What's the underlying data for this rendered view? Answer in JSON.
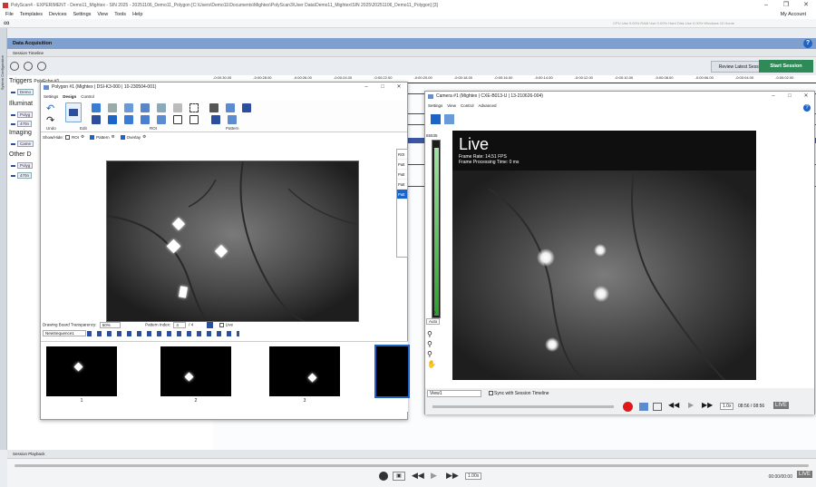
{
  "app": {
    "title": "PolyScan4 - EXPERIMENT - Demo11_Mightex - SIN 2025 - 20251106_Demo11_Polygon [C:\\Users\\Demo11\\Documents\\Mightex\\PolyScan3\\User Data\\Demo11_Mightex\\SIN 2025\\20251106_Demo11_Polygon] [3]",
    "account": "My Account",
    "status": "CPU Use 0.00%  RAM Use 0.00%  Hard Disk Use 0.00%  Windows 10 Home",
    "menu": [
      "File",
      "Templates",
      "Devices",
      "Settings",
      "View",
      "Tools",
      "Help"
    ]
  },
  "side_label": "System Configuration",
  "data_acq": {
    "header": "Data Acquisition",
    "session_timeline": "Session Timeline",
    "review_btn": "Review Latest Session",
    "start_btn": "Start Session"
  },
  "ruler_ticks": [
    "-0:00:30.00",
    "-0:00:28.00",
    "-0:00:26.00",
    "-0:00:24.00",
    "-0:00:22.00",
    "-0:00:20.00",
    "-0:00:18.00",
    "-0:00:16.00",
    "-0:00:14.00",
    "-0:00:12.00",
    "-0:00:10.00",
    "-0:00:08.00",
    "-0:00:06.00",
    "-0:00:04.00",
    "-0:00:02.00"
  ],
  "timeline": {
    "sections": [
      "Triggers",
      "Illuminat",
      "Imaging",
      "Other D"
    ],
    "triggers_sub": "PolyEcho #1",
    "items": [
      "Demo",
      "Polyg",
      "470n",
      "Came",
      "Polyg",
      "470n"
    ]
  },
  "polygon": {
    "title": "Polygon #1 (Mightex | DSI-K3-000 | 10-230504-001)",
    "tabs": [
      "Settings",
      "Design",
      "Control"
    ],
    "calibrated": "Calibrated",
    "groups": [
      "Undo",
      "Edit",
      "ROI",
      "Pattern"
    ],
    "showhide": "Show/Hide:",
    "roi_label": "ROI",
    "pattern_label": "Pattern",
    "overlay_label": "Overlay",
    "roi_list_head": "ROI",
    "roi_list": [
      "Patt",
      "Patt",
      "Patt",
      "Patt"
    ],
    "transparency_label": "Drawing Board Transparency:",
    "transparency_value": "50%",
    "pattern_index_label": "Pattern Index:",
    "pattern_index": "4",
    "pattern_total": "/ 4",
    "live_label": "Live",
    "sequence": "NewSequence1",
    "thumb_labels": [
      "1",
      "2",
      "3"
    ]
  },
  "camera": {
    "title": "Camera #1 (Mightex | CXE-B013-U | 13-210626-004)",
    "tabs": [
      "Settings",
      "View",
      "Control",
      "Advanced"
    ],
    "hist_max": "65535",
    "hist_min": "0",
    "live": "Live",
    "fps": "Frame Rate: 14.51 FPS",
    "proc": "Frame Processing Time: 0 ms",
    "auto": "Auto",
    "view_name": "View1",
    "sync": "Sync with Session Timeline",
    "speed": "1.0x",
    "time": "08:56 / 08:56",
    "live_btn": "LIVE"
  },
  "playback": {
    "label": "Session Playback",
    "speed": "1.00x",
    "time": "00:00/00:00",
    "live_btn": "LIVE"
  }
}
